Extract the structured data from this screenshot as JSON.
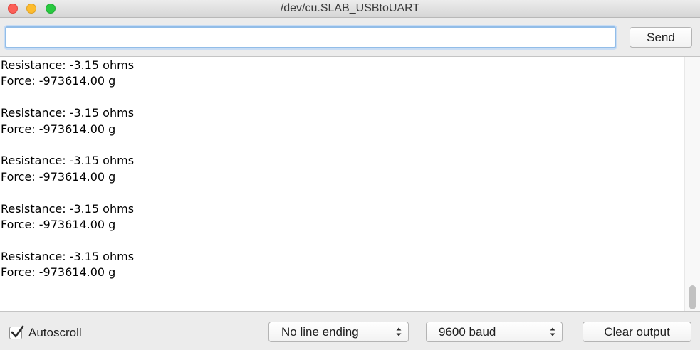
{
  "window": {
    "title": "/dev/cu.SLAB_USBtoUART"
  },
  "toolbar": {
    "input_value": "",
    "send_label": "Send"
  },
  "output": {
    "lines": [
      "Resistance: -3.15 ohms",
      "Force: -973614.00 g",
      "",
      "Resistance: -3.15 ohms",
      "Force: -973614.00 g",
      "",
      "Resistance: -3.15 ohms",
      "Force: -973614.00 g",
      "",
      "Resistance: -3.15 ohms",
      "Force: -973614.00 g",
      "",
      "Resistance: -3.15 ohms",
      "Force: -973614.00 g"
    ]
  },
  "bottombar": {
    "autoscroll_label": "Autoscroll",
    "autoscroll_checked": true,
    "line_ending_value": "No line ending",
    "baud_value": "9600 baud",
    "clear_label": "Clear output"
  },
  "icons": {
    "window_controls": [
      "close-icon",
      "minimize-icon",
      "zoom-icon"
    ],
    "checkbox": "checkmark-icon",
    "select_arrows": "updown-arrows-icon"
  },
  "colors": {
    "close": "#fc5f57",
    "minimize": "#fdbc2e",
    "zoom": "#29c940",
    "input_focus": "#92bde8",
    "window_bg": "#ececec"
  }
}
